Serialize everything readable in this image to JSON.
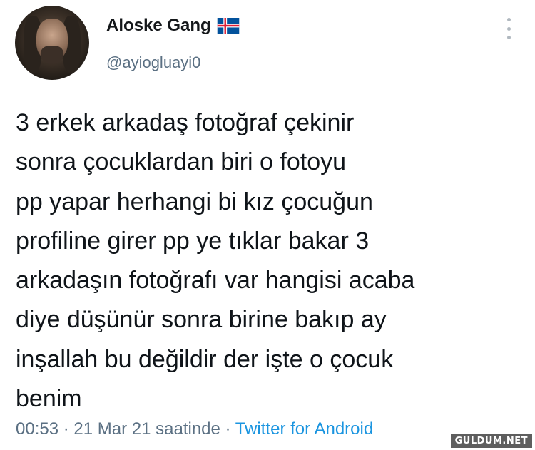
{
  "profile": {
    "display_name": "Aloske Gang",
    "flag_icon": "iceland-flag-icon",
    "handle": "@ayiogluayi0"
  },
  "tweet": {
    "text": "3 erkek arkadaş fotoğraf çekinir\nsonra çocuklardan biri o fotoyu\npp yapar herhangi bi kız çocuğun\nprofiline girer pp ye tıklar bakar 3\narkadaşın fotoğrafı var hangisi acaba\ndiye düşünür sonra birine bakıp ay\ninşallah bu değildir der işte o çocuk\nbenim"
  },
  "meta": {
    "time": "00:53",
    "date": "21 Mar 21 saatinde",
    "separator": " · ",
    "source": "Twitter for Android"
  },
  "watermark": "GULDUM.NET",
  "colors": {
    "text": "#0f1419",
    "secondary": "#5b7083",
    "link": "#1b95e0"
  }
}
